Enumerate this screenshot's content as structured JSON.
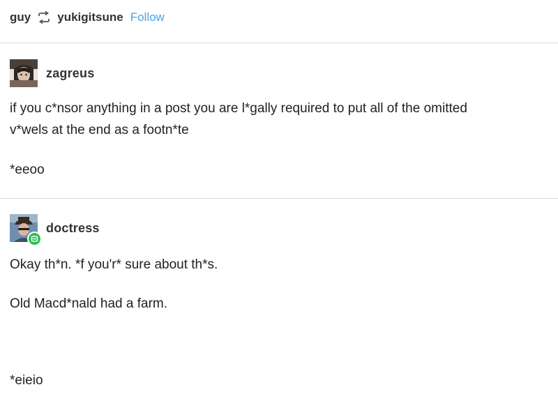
{
  "header": {
    "reblogger": "guy",
    "source": "yukigitsune",
    "follow_label": "Follow"
  },
  "posts": [
    {
      "username": "zagreus",
      "lines": [
        "if you c*nsor anything in a post you are l*gally required to put all of the omitted",
        "v*wels at the end as a footn*te"
      ],
      "footnote": "*eeoo"
    },
    {
      "username": "doctress",
      "line1": "Okay th*n. *f you'r* sure about th*s.",
      "line2": "Old Macd*nald had a farm.",
      "footnote": "*eieio"
    }
  ],
  "colors": {
    "follow": "#4aa3df",
    "divider": "#dcdcdc",
    "badge": "#27c24c"
  }
}
